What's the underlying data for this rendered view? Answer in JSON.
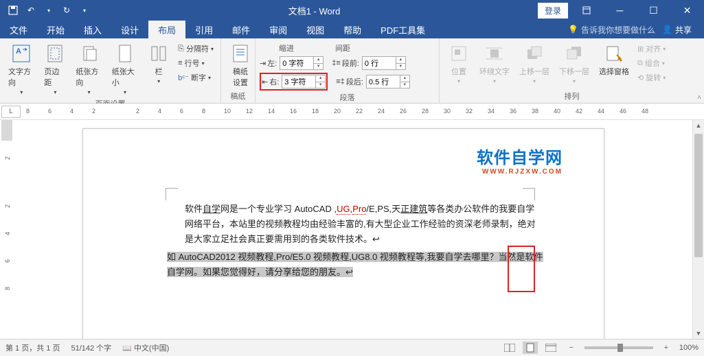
{
  "titlebar": {
    "title": "文档1 - Word",
    "login": "登录"
  },
  "tabs": {
    "file": "文件",
    "home": "开始",
    "insert": "插入",
    "design": "设计",
    "layout": "布局",
    "references": "引用",
    "mailings": "邮件",
    "review": "审阅",
    "view": "视图",
    "help": "帮助",
    "pdf": "PDF工具集",
    "tellme": "告诉我你想要做什么",
    "share": "共享"
  },
  "ribbon": {
    "page_setup": {
      "text_direction": "文字方向",
      "margins": "页边距",
      "orientation": "纸张方向",
      "size": "纸张大小",
      "columns": "栏",
      "breaks": "分隔符",
      "line_numbers": "行号",
      "hyphenation": "断字",
      "label": "页面设置"
    },
    "manuscript": {
      "settings": "稿纸\n设置",
      "label": "稿纸"
    },
    "paragraph": {
      "indent_header": "缩进",
      "spacing_header": "间距",
      "left_label": "左:",
      "left_value": "0 字符",
      "right_label": "右:",
      "right_value": "3 字符",
      "before_label": "段前:",
      "before_value": "0 行",
      "after_label": "段后:",
      "after_value": "0.5 行",
      "label": "段落"
    },
    "arrange": {
      "position": "位置",
      "wrap": "环绕文字",
      "forward": "上移一层",
      "backward": "下移一层",
      "selection_pane": "选择窗格",
      "align": "对齐",
      "group": "组合",
      "rotate": "旋转",
      "label": "排列"
    }
  },
  "ruler": {
    "corner": "L",
    "h_ticks": [
      "8",
      "6",
      "4",
      "2",
      "",
      "2",
      "4",
      "6",
      "8",
      "10",
      "12",
      "14",
      "16",
      "18",
      "20",
      "22",
      "24",
      "26",
      "28",
      "30",
      "32",
      "34",
      "36",
      "38",
      "40",
      "42",
      "44",
      "46",
      "48"
    ],
    "v_ticks": [
      "",
      "2",
      "",
      "2",
      "4",
      "6",
      "8"
    ]
  },
  "document": {
    "watermark_l1": "软件自学网",
    "watermark_l2": "WWW.RJZXW.COM",
    "p1_a": "软件",
    "p1_u1": "自学",
    "p1_b": "网是一个专业学习 AutoCAD ,",
    "p1_u2": "UG",
    "p1_c": ",",
    "p1_u3": "Pro",
    "p1_d": "/E,PS,天",
    "p1_u4": "正建筑",
    "p1_e": "等各类办公软件的我要自学网络平台，本站里的视频教程均由经验丰富的,有大型企业工作经验的资深老师录制，绝对是大家立足社会真正要需用到的各类软件技术。↩",
    "p2": "如 AutoCAD2012 视频教程,Pro/E5.0 视频教程,UG8.0 视频教程等,我要自学去哪里？当然是软件自学网。如果您觉得好，请分享给您的朋友。↩"
  },
  "statusbar": {
    "page": "第 1 页，共 1 页",
    "words": "51/142 个字",
    "lang": "中文(中国)",
    "zoom": "100%"
  }
}
